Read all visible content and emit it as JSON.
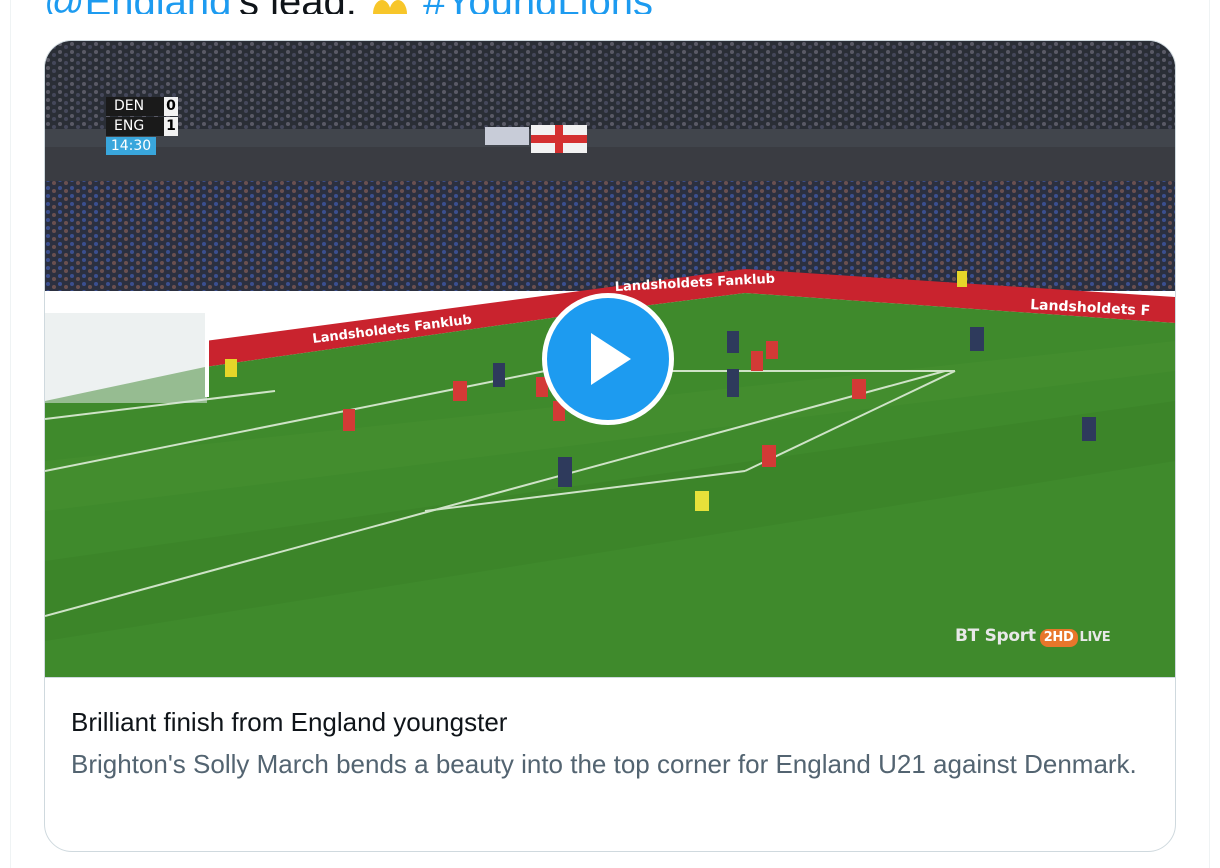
{
  "tweet": {
    "mention": "@England",
    "text_after_mention": "'s lead.",
    "hashtag": "#YoungLions",
    "emoji_name": "raising-hands-emoji"
  },
  "video": {
    "scoreboard": {
      "home_team": "DEN",
      "home_score": "0",
      "away_team": "ENG",
      "away_score": "1",
      "clock": "14:30"
    },
    "broadcaster": {
      "name": "BT Sport",
      "channel": "2HD",
      "status": "LIVE"
    },
    "ad_boards": {
      "left": "Landsholdets Fanklub",
      "center": "Landsholdets Fanklub",
      "right": "Landsholdets F"
    },
    "play_icon": "play-icon"
  },
  "card": {
    "title": "Brilliant finish from England youngster",
    "description": "Brighton's Solly March bends a beauty into the top corner for England U21 against Denmark."
  },
  "colors": {
    "accent": "#1d9bf0",
    "text_primary": "#0f1419",
    "text_secondary": "#536471",
    "border": "#cfd9de",
    "pitch": "#3f8a2c"
  }
}
